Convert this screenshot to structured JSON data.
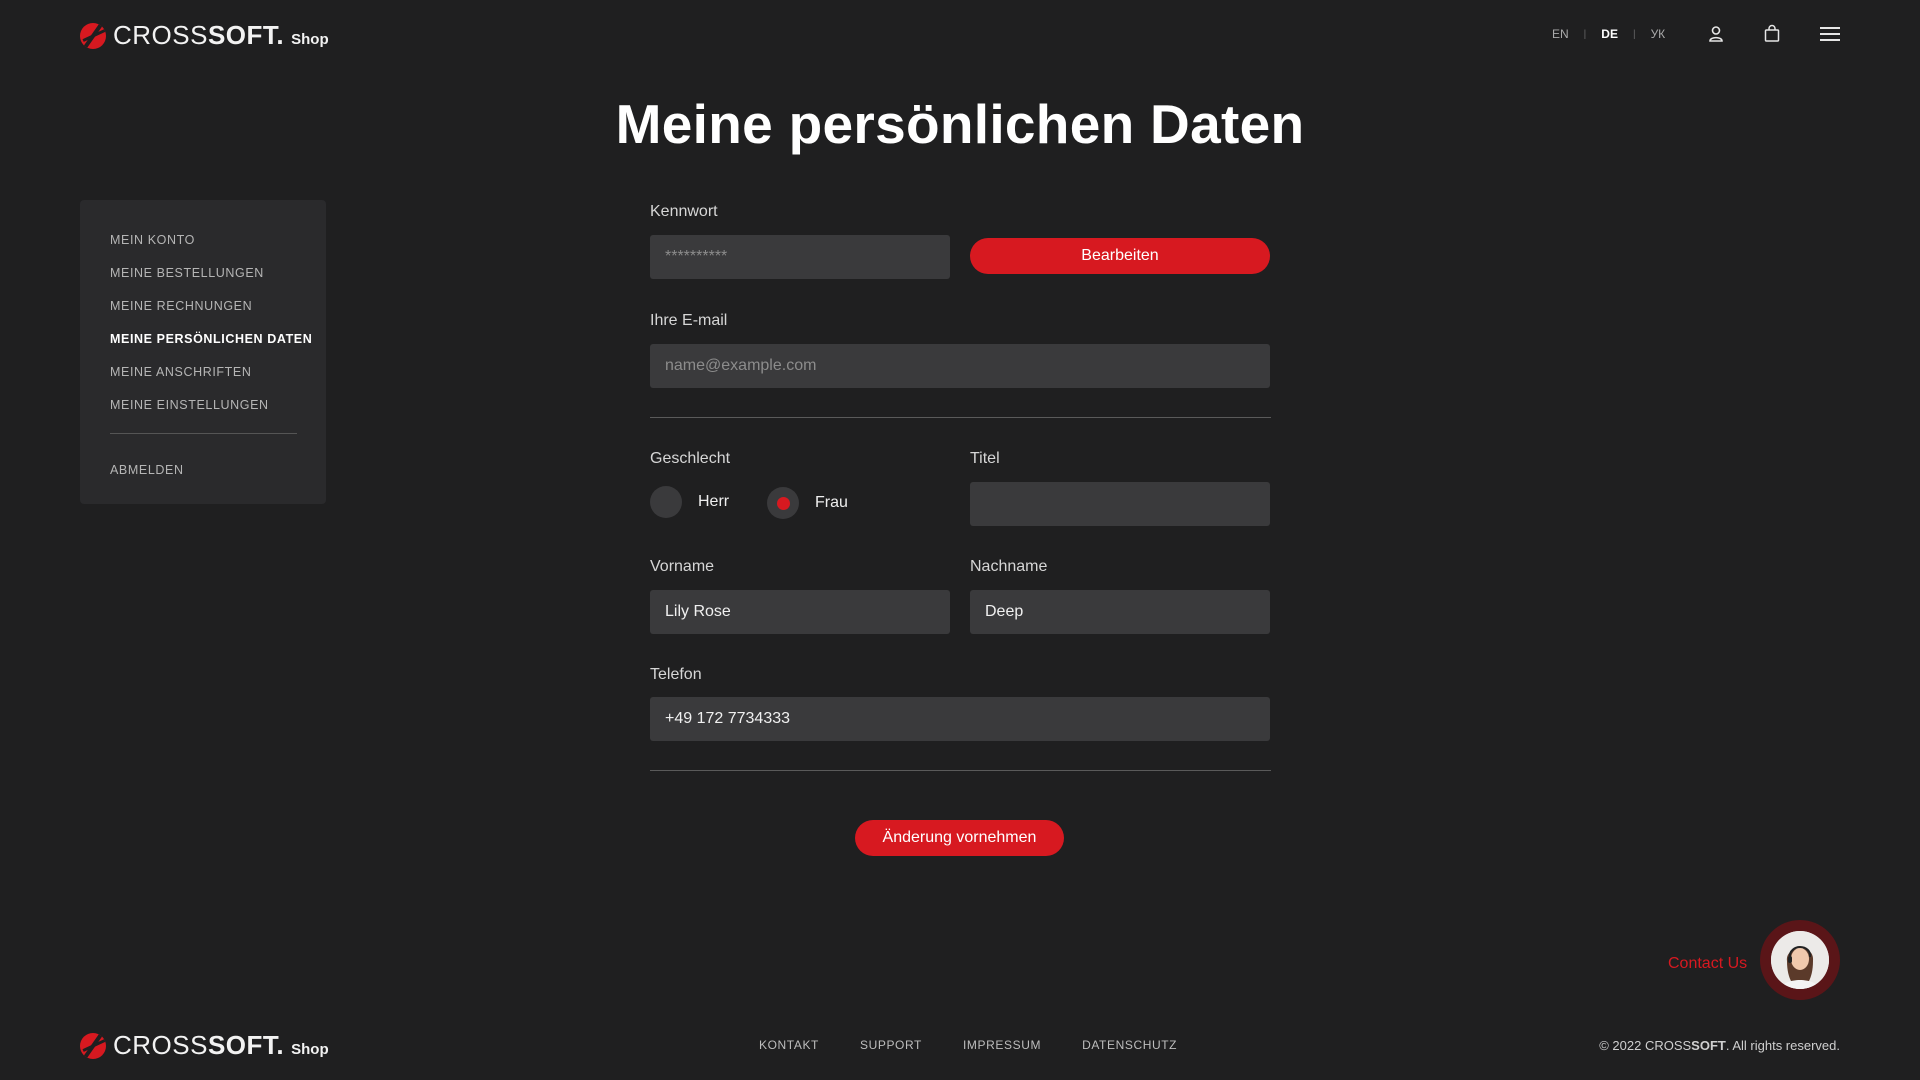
{
  "brand": {
    "cross": "CROSS",
    "soft": "SOFT.",
    "shop": "Shop"
  },
  "header": {
    "languages": [
      {
        "code": "EN",
        "active": false
      },
      {
        "code": "DE",
        "active": true
      },
      {
        "code": "УК",
        "active": false
      }
    ],
    "icons": [
      "user-icon",
      "shopping-bag-icon",
      "menu-icon"
    ]
  },
  "page_title": "Meine persönlichen Daten",
  "sidebar": {
    "items": [
      {
        "label": "MEIN KONTO",
        "active": false
      },
      {
        "label": "MEINE BESTELLUNGEN",
        "active": false
      },
      {
        "label": "MEINE RECHNUNGEN",
        "active": false
      },
      {
        "label": "MEINE PERSÖNLICHEN DATEN",
        "active": true
      },
      {
        "label": "MEINE ANSCHRIFTEN",
        "active": false
      },
      {
        "label": "MEINE EINSTELLUNGEN",
        "active": false
      }
    ],
    "logout_label": "ABMELDEN"
  },
  "form": {
    "password_label": "Kennwort",
    "password_placeholder": "**********",
    "edit_button": "Bearbeiten",
    "email_label": "Ihre E-mail",
    "email_placeholder": "name@example.com",
    "gender_label": "Geschlecht",
    "gender_options": [
      {
        "label": "Herr",
        "selected": false
      },
      {
        "label": "Frau",
        "selected": true
      }
    ],
    "title_label": "Titel",
    "title_value": "",
    "firstname_label": "Vorname",
    "firstname_value": "Lily Rose",
    "lastname_label": "Nachname",
    "lastname_value": "Deep",
    "phone_label": "Telefon",
    "phone_value": "+49 172 7734333",
    "submit_button": "Änderung vornehmen"
  },
  "contact": {
    "label": "Contact Us"
  },
  "footer": {
    "links": [
      "KONTAKT",
      "SUPPORT",
      "IMPRESSUM",
      "DATENSCHUTZ"
    ],
    "copyright_prefix": "© 2022 CROSS",
    "copyright_brand": "SOFT",
    "copyright_suffix": ". All rights reserved."
  },
  "colors": {
    "accent": "#d71920",
    "background": "#1f1f20",
    "panel": "#2a2a2c",
    "input": "#3a3a3c"
  }
}
